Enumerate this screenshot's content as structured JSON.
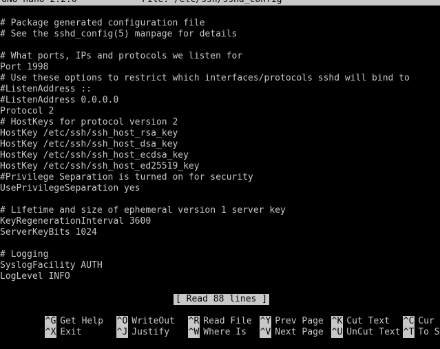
{
  "titlebar": {
    "app": "GNU nano 2.2.6",
    "file": "File: /etc/ssh/sshd_config"
  },
  "editor": {
    "lines": [
      "# Package generated configuration file",
      "# See the sshd_config(5) manpage for details",
      "",
      "# What ports, IPs and protocols we listen for",
      "Port 1998",
      "# Use these options to restrict which interfaces/protocols sshd will bind to",
      "#ListenAddress ::",
      "#ListenAddress 0.0.0.0",
      "Protocol 2",
      "# HostKeys for protocol version 2",
      "HostKey /etc/ssh/ssh_host_rsa_key",
      "HostKey /etc/ssh/ssh_host_dsa_key",
      "HostKey /etc/ssh/ssh_host_ecdsa_key",
      "HostKey /etc/ssh/ssh_host_ed25519_key",
      "#Privilege Separation is turned on for security",
      "UsePrivilegeSeparation yes",
      "",
      "# Lifetime and size of ephemeral version 1 server key",
      "KeyRegenerationInterval 3600",
      "ServerKeyBits 1024",
      "",
      "# Logging",
      "SyslogFacility AUTH",
      "LogLevel INFO"
    ]
  },
  "status": {
    "message": "[ Read 88 lines ]"
  },
  "shortcuts": {
    "row1": [
      {
        "key": "^G",
        "label": "Get Help"
      },
      {
        "key": "^O",
        "label": "WriteOut"
      },
      {
        "key": "^R",
        "label": "Read File"
      },
      {
        "key": "^Y",
        "label": "Prev Page"
      },
      {
        "key": "^K",
        "label": "Cut Text"
      },
      {
        "key": "^C",
        "label": "Cur Pos"
      }
    ],
    "row2": [
      {
        "key": "^X",
        "label": "Exit"
      },
      {
        "key": "^J",
        "label": "Justify"
      },
      {
        "key": "^W",
        "label": "Where Is"
      },
      {
        "key": "^V",
        "label": "Next Page"
      },
      {
        "key": "^U",
        "label": "UnCut Text"
      },
      {
        "key": "^T",
        "label": "To Spell"
      }
    ]
  },
  "colors": {
    "background": "#000000",
    "foreground": "#c8c8c8"
  }
}
